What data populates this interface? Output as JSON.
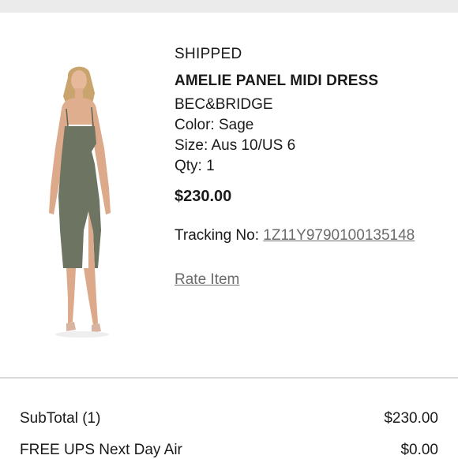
{
  "order_item": {
    "status": "SHIPPED",
    "name": "AMELIE PANEL MIDI DRESS",
    "brand": "BEC&BRIDGE",
    "color_line": "Color: Sage",
    "size_line": "Size: Aus 10/US 6",
    "qty_line": "Qty: 1",
    "price": "$230.00",
    "tracking_label": "Tracking No: ",
    "tracking_number": "1Z11Y9790100135148",
    "rate_label": "Rate Item",
    "dress_color": "#6d7462"
  },
  "summary": {
    "subtotal_label": "SubTotal (1)",
    "subtotal_value": "$230.00",
    "shipping_label": "FREE UPS Next Day Air",
    "shipping_value": "$0.00"
  }
}
